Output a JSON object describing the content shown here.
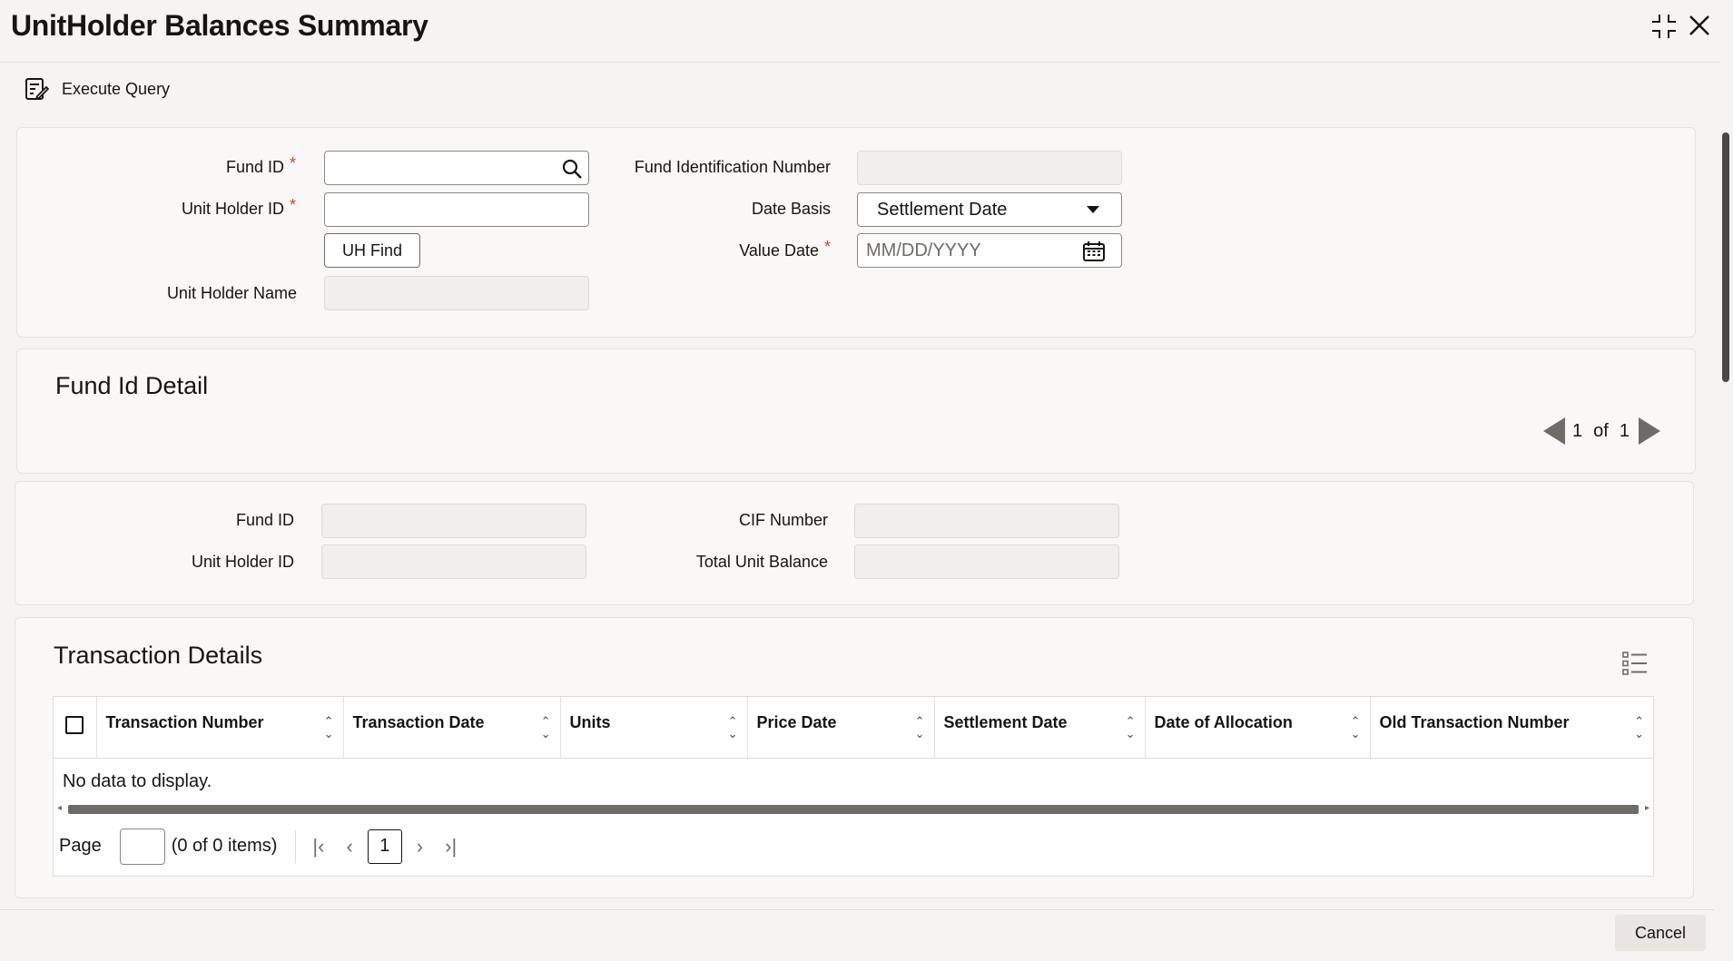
{
  "window": {
    "title": "UnitHolder Balances Summary"
  },
  "toolbar": {
    "execute_query_label": "Execute Query"
  },
  "criteria": {
    "fund_id_label": "Fund ID",
    "unit_holder_id_label": "Unit Holder ID",
    "uh_find_label": "UH Find",
    "unit_holder_name_label": "Unit Holder Name",
    "fund_identification_number_label": "Fund Identification Number",
    "date_basis_label": "Date Basis",
    "date_basis_value": "Settlement Date",
    "value_date_label": "Value Date",
    "value_date_placeholder": "MM/DD/YYYY",
    "required_marker": "*"
  },
  "fund_id_detail": {
    "title": "Fund Id Detail",
    "pager_current": "1",
    "pager_of": "of",
    "pager_total": "1"
  },
  "detail_fields": {
    "fund_id_label": "Fund ID",
    "unit_holder_id_label": "Unit Holder ID",
    "cif_number_label": "CIF Number",
    "total_unit_balance_label": "Total Unit Balance"
  },
  "transaction_details": {
    "title": "Transaction Details",
    "columns": [
      "Transaction Number",
      "Transaction Date",
      "Units",
      "Price Date",
      "Settlement Date",
      "Date of Allocation",
      "Old Transaction Number"
    ],
    "no_data_text": "No data to display.",
    "page_label": "Page",
    "items_text": "(0 of 0 items)",
    "current_page": "1"
  },
  "footer": {
    "cancel_label": "Cancel"
  }
}
